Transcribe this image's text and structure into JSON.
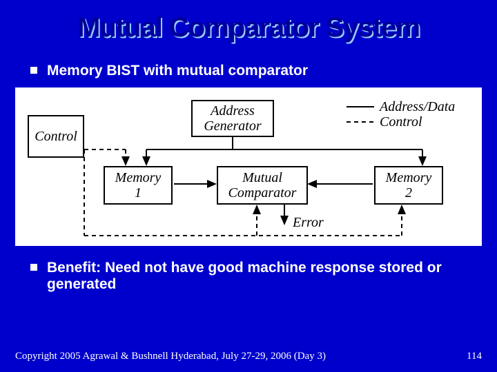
{
  "title": "Mutual Comparator System",
  "bullets": {
    "b1": "Memory BIST with mutual comparator",
    "b2": "Benefit: Need not have good machine response stored or generated"
  },
  "diagram": {
    "control": "Control",
    "address_generator_l1": "Address",
    "address_generator_l2": "Generator",
    "memory1_l1": "Memory",
    "memory1_l2": "1",
    "mutual_l1": "Mutual",
    "mutual_l2": "Comparator",
    "memory2_l1": "Memory",
    "memory2_l2": "2",
    "legend_addr": "Address/Data",
    "legend_ctrl": "Control",
    "error": "Error"
  },
  "footer": {
    "copyright": "Copyright 2005 Agrawal & Bushnell   Hyderabad, July 27-29, 2006 (Day 3)",
    "page": "114"
  }
}
